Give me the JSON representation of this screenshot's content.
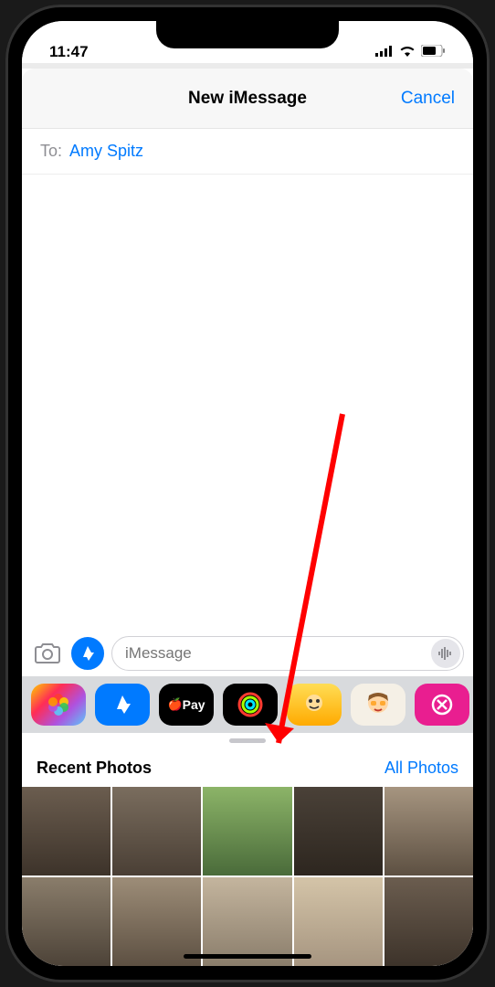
{
  "status_bar": {
    "time": "11:47"
  },
  "header": {
    "title": "New iMessage",
    "cancel": "Cancel"
  },
  "compose": {
    "to_label": "To:",
    "recipient": "Amy Spitz",
    "input_placeholder": "iMessage"
  },
  "apps": {
    "apple_pay": "Pay"
  },
  "photos": {
    "recent_label": "Recent Photos",
    "all_photos": "All Photos"
  }
}
